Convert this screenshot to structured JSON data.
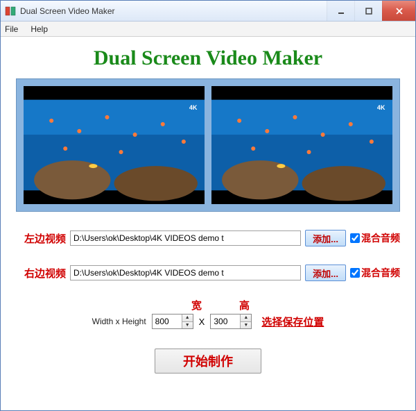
{
  "window": {
    "title": "Dual Screen Video Maker"
  },
  "menu": {
    "file": "File",
    "help": "Help"
  },
  "heading": "Dual Screen Video Maker",
  "left": {
    "label": "左边视频",
    "path": "D:\\Users\\ok\\Desktop\\4K VIDEOS demo t",
    "add": "添加...",
    "mix": "混合音频"
  },
  "right": {
    "label": "右边视频",
    "path": "D:\\Users\\ok\\Desktop\\4K VIDEOS demo t",
    "add": "添加...",
    "mix": "混合音频"
  },
  "dims": {
    "width_header": "宽",
    "height_header": "高",
    "wh_label": "Width x Height",
    "width": "800",
    "height": "300",
    "x": "X",
    "save_location": "选择保存位置"
  },
  "start": "开始制作"
}
